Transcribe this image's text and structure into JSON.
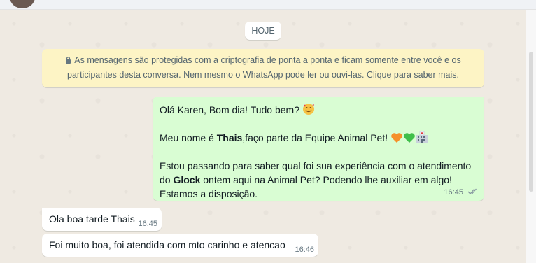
{
  "date_divider": "HOJE",
  "encryption_notice": {
    "line1": "As mensagens são protegidas com a criptografia de ponta a ponta e ficam somente entre você e os",
    "line2": "participantes desta conversa. Nem mesmo o WhatsApp pode ler ou ouvi-las. Clique para saber mais."
  },
  "messages": {
    "outgoing": {
      "line1": "Olá Karen, Bom dia! Tudo bem?",
      "line2_pre": "Meu nome é ",
      "line2_bold": "Thais",
      "line2_post": ",faço parte da Equipe Animal Pet!",
      "line3": "Estou passando para saber qual foi sua experiência com o atendimento",
      "line4_pre": "do ",
      "line4_bold": "Glock",
      "line4_post": " ontem aqui na Animal Pet? Podendo lhe auxiliar em algo!",
      "line5": "Estamos a disposição.",
      "time": "16:45"
    },
    "incoming": [
      {
        "text": "Ola boa tarde Thais",
        "time": "16:45"
      },
      {
        "text": "Foi muito boa, foi atendida com mto carinho e atencao",
        "time": "16:46"
      }
    ]
  },
  "icons": {
    "lock": "lock-icon",
    "read_receipt": "double-check-icon",
    "emoji_face": "smiling-face-with-hearts-icon",
    "emoji_orange_heart": "orange-heart-icon",
    "emoji_green_heart": "green-heart-icon",
    "emoji_hospital": "hospital-icon"
  },
  "colors": {
    "chat_background": "#efeae2",
    "outgoing_bubble": "#d9fdd3",
    "incoming_bubble": "#ffffff",
    "notice_background": "#fdf4c5",
    "read_receipt": "#8696a0"
  }
}
